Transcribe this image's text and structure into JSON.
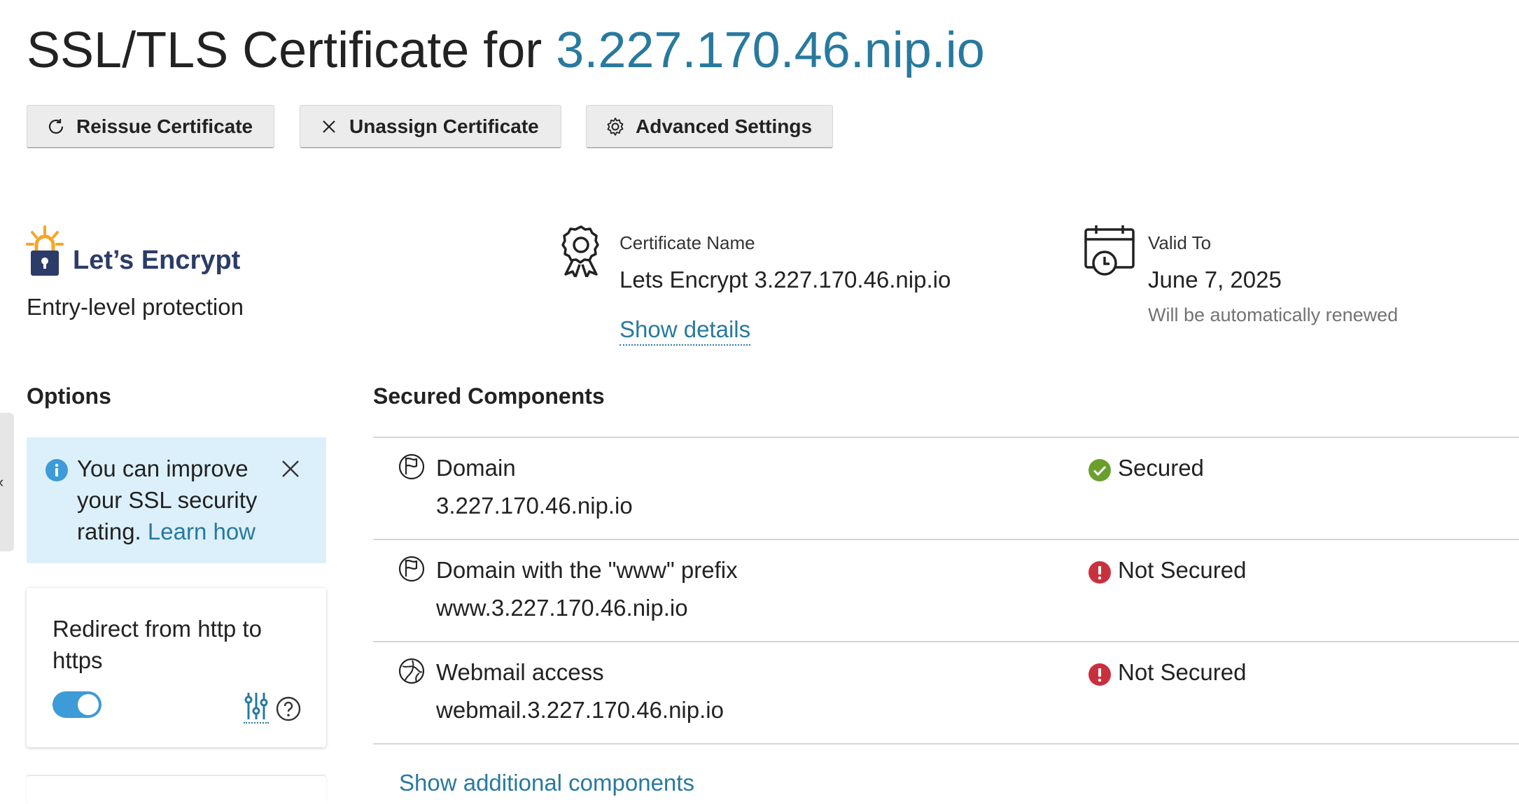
{
  "page": {
    "title_prefix": "SSL/TLS Certificate for",
    "title_domain": "3.227.170.46.nip.io"
  },
  "toolbar": {
    "reissue_label": "Reissue Certificate",
    "unassign_label": "Unassign Certificate",
    "advanced_label": "Advanced Settings"
  },
  "provider": {
    "logo_text": "Let’s Encrypt",
    "tagline": "Entry-level protection",
    "logo_colors": {
      "lock": "#2c3c69",
      "sun": "#f4a627",
      "text": "#2c3c69"
    }
  },
  "certificate": {
    "name_label": "Certificate Name",
    "name_value": "Lets Encrypt 3.227.170.46.nip.io",
    "show_details": "Show details",
    "valid_label": "Valid To",
    "valid_value": "June 7, 2025",
    "valid_note": "Will be automatically renewed"
  },
  "options": {
    "heading": "Options",
    "info_text": "You can improve your SSL security rating.",
    "info_link": "Learn how",
    "redirect_label": "Redirect from http to https",
    "redirect_enabled": true
  },
  "secured_components": {
    "heading": "Secured Components",
    "rows": [
      {
        "name": "Domain",
        "value": "3.227.170.46.nip.io",
        "status": "Secured",
        "icon": "flag-icon"
      },
      {
        "name": "Domain with the \"www\" prefix",
        "value": "www.3.227.170.46.nip.io",
        "status": "Not Secured",
        "icon": "flag-icon"
      },
      {
        "name": "Webmail access",
        "value": "webmail.3.227.170.46.nip.io",
        "status": "Not Secured",
        "icon": "globe-icon"
      }
    ],
    "show_more": "Show additional components"
  },
  "colors": {
    "link": "#28799e",
    "secured": "#6a9f2e",
    "not_secured": "#c9303e",
    "info_bg": "#dcf0fb",
    "toggle_on": "#3d9bd8"
  }
}
